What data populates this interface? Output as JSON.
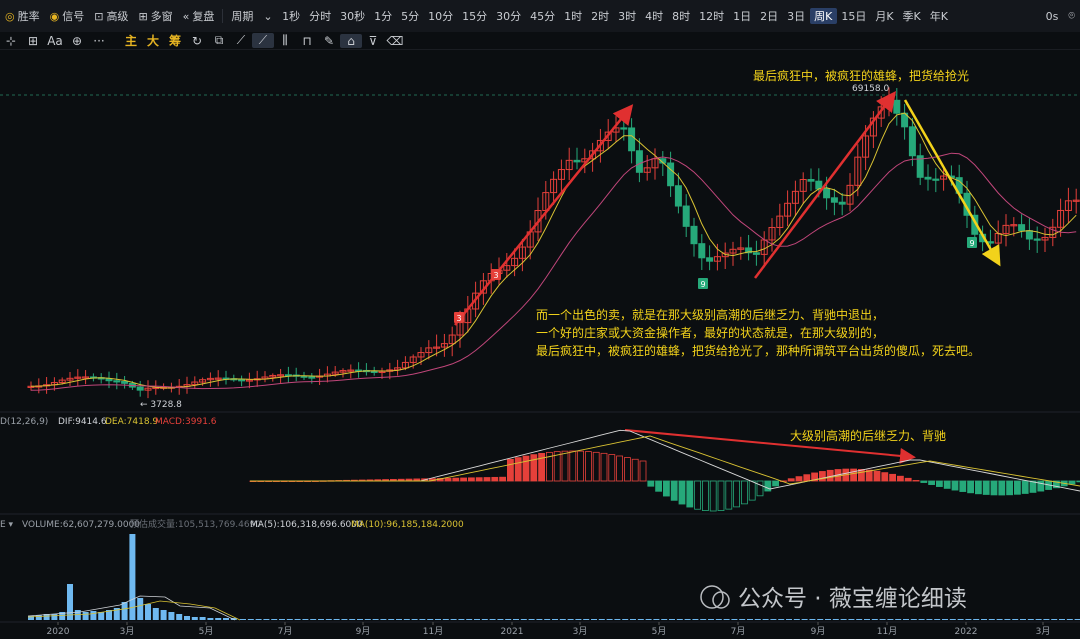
{
  "topbar": {
    "left_items": [
      {
        "id": "winrate",
        "icon": "target-icon",
        "label": "胜率"
      },
      {
        "id": "signal",
        "icon": "coin-icon",
        "label": "信号"
      },
      {
        "id": "advanced",
        "icon": "folder-icon",
        "label": "高级"
      },
      {
        "id": "multi",
        "icon": "grid-icon",
        "label": "多窗"
      },
      {
        "id": "replay",
        "icon": "rewind-icon",
        "label": "复盘"
      }
    ],
    "period_label": "周期",
    "timeframes": [
      "1秒",
      "分时",
      "30秒",
      "1分",
      "5分",
      "10分",
      "15分",
      "30分",
      "45分",
      "1时",
      "2时",
      "3时",
      "4时",
      "8时",
      "12时",
      "1日",
      "2日",
      "3日",
      "周K",
      "15日",
      "月K",
      "季K",
      "年K"
    ],
    "active_timeframe": "周K",
    "right_label": "0s"
  },
  "toolbar": {
    "tools": [
      "crosshair-icon",
      "text-icon",
      "add-icon",
      "more-icon"
    ],
    "gold_labels": [
      "主",
      "大",
      "筹"
    ],
    "draw_tools": [
      "refresh-icon",
      "copy-icon",
      "ruler-icon",
      "trend-line-icon",
      "bars-icon",
      "lock-icon",
      "edit-icon",
      "magnet-icon",
      "filter-icon",
      "trash-icon"
    ]
  },
  "chart_data": {
    "type": "candlestick",
    "price_high_label": "69158.0",
    "price_low_label": "3728.8",
    "indicator_counts": [
      "3",
      "3",
      "9",
      "9"
    ],
    "x_ticks": [
      "2020",
      "3月",
      "5月",
      "7月",
      "9月",
      "11月",
      "2021",
      "3月",
      "5月",
      "7月",
      "9月",
      "11月",
      "2022",
      "3月"
    ],
    "macd": {
      "legend": "D(12,26,9)",
      "dif": "DIF:9414.6",
      "dea": "DEA:7418.9",
      "macd": "MACD:3991.6"
    },
    "volume": {
      "legend": "E ▾",
      "volume": "VOLUME:62,607,279.0000",
      "estimated": "预估成交量:105,513,769.4690",
      "ma5": "MA(5):106,318,696.6000",
      "ma10": "MA(10):96,185,184.2000"
    },
    "annotations": {
      "top": "最后疯狂中，被疯狂的雄蜂，把货给抢光",
      "body": [
        "而一个出色的卖，就是在那大级别高潮的后继乏力、背驰中退出，",
        "一个好的庄家或大资金操作者，最好的状态就是，在那大级别的，",
        "最后疯狂中，被疯狂的雄蜂，把货给抢光了，那种所谓筑平台出货的傻瓜，死去吧。"
      ],
      "macd": "大级别高潮的后继乏力、背驰"
    },
    "colors": {
      "up": "#e5403a",
      "down": "#26a97a",
      "ma_fast": "#d9c233",
      "ma_slow": "#c0467a",
      "annotation": "#f2d21b",
      "arrow": "#e03030",
      "dif": "#d9d9d9",
      "dea": "#d9c233",
      "vol_up": "#6fb9f0"
    }
  },
  "watermark": {
    "text": "公众号 · 薇宝缠论细读"
  }
}
